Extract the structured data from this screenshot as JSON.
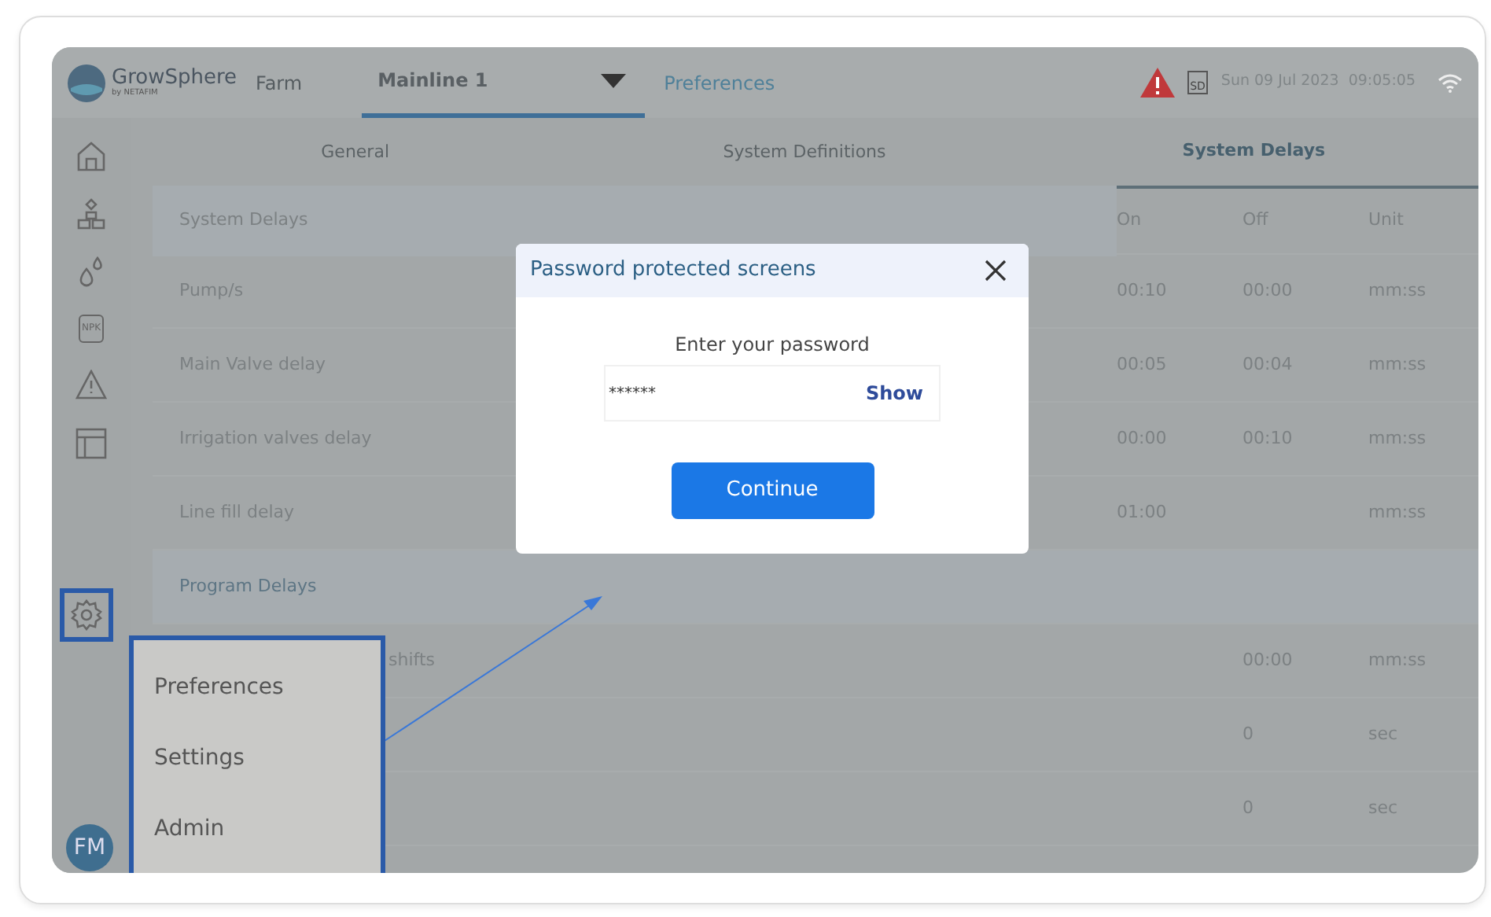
{
  "header": {
    "brand": "GrowSphere",
    "brand_sub": "by NETAFIM",
    "farm": "Farm",
    "mainline": "Mainline 1",
    "link": "Preferences",
    "sd_label": "SD",
    "datetime": "Sun 09 Jul 2023  09:05:05"
  },
  "sidebar": {
    "items": [
      {
        "kind": "home",
        "selected": false
      },
      {
        "kind": "sites",
        "selected": false
      },
      {
        "kind": "drops",
        "selected": false
      },
      {
        "kind": "npk",
        "label": "NPK",
        "selected": false
      },
      {
        "kind": "alert",
        "selected": false
      },
      {
        "kind": "layout",
        "selected": false
      },
      {
        "kind": "gear",
        "selected": true
      }
    ],
    "avatar": "FM"
  },
  "tabs": [
    {
      "label": "General",
      "selected": false
    },
    {
      "label": "System Definitions",
      "selected": false
    },
    {
      "label": "System Delays",
      "selected": true
    }
  ],
  "table": {
    "columns": [
      "System Delays",
      "On",
      "Off",
      "Unit"
    ],
    "rows": [
      {
        "kind": "row",
        "cells": [
          "Pump/s",
          "00:10",
          "00:00",
          "mm:ss"
        ]
      },
      {
        "kind": "row",
        "cells": [
          "Main Valve delay",
          "00:05",
          "00:04",
          "mm:ss"
        ]
      },
      {
        "kind": "row",
        "cells": [
          "Irrigation valves delay",
          "00:00",
          "00:10",
          "mm:ss"
        ]
      },
      {
        "kind": "row",
        "cells": [
          "Line fill delay",
          "01:00",
          "",
          "mm:ss"
        ]
      },
      {
        "kind": "section",
        "cells": [
          "Program Delays"
        ]
      },
      {
        "kind": "row",
        "cells": [
          "shifts",
          "",
          "00:00",
          "mm:ss"
        ]
      },
      {
        "kind": "row",
        "cells": [
          "",
          "",
          "0",
          "sec"
        ]
      },
      {
        "kind": "row",
        "cells": [
          "",
          "",
          "0",
          "sec"
        ]
      }
    ]
  },
  "menu": {
    "items": [
      "Preferences",
      "Settings",
      "Admin"
    ]
  },
  "modal": {
    "title": "Password protected screens",
    "prompt": "Enter your password",
    "password": "******",
    "show": "Show",
    "button": "Continue"
  }
}
